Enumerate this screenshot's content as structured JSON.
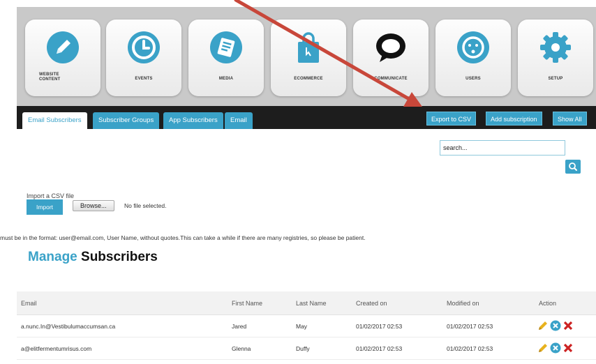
{
  "modules": [
    {
      "label": "WEBSITE",
      "label2": "CONTENT",
      "icon": "pencil-icon"
    },
    {
      "label": "EVENTS",
      "icon": "clock-icon"
    },
    {
      "label": "MEDIA",
      "icon": "media-list-icon"
    },
    {
      "label": "ECOMMERCE",
      "icon": "shopping-bag-icon"
    },
    {
      "label": "COMMUNICATE",
      "icon": "speech-bubble-icon"
    },
    {
      "label": "USERS",
      "icon": "user-face-icon"
    },
    {
      "label": "SETUP",
      "icon": "gear-icon"
    }
  ],
  "tabs": [
    "Email Subscribers",
    "Subscriber Groups",
    "App Subscribers",
    "Email"
  ],
  "actions": {
    "export": "Export to CSV",
    "add": "Add subscription",
    "show_all": "Show All"
  },
  "search": {
    "placeholder": "search..."
  },
  "import": {
    "label": "Import a CSV file",
    "button": "Import",
    "browse": "Browse...",
    "no_file": "No file selected."
  },
  "format_note": "must be in the format: user@email.com, User Name, without quotes.This can take a while if there are many registries, so please be patient.",
  "title": {
    "word1": "Manage",
    "word2": "Subscribers"
  },
  "table": {
    "columns": [
      "Email",
      "First Name",
      "Last Name",
      "Created on",
      "Modified on",
      "Action"
    ],
    "rows": [
      [
        "a.nunc.In@Vestibulumaccumsan.ca",
        "Jared",
        "May",
        "01/02/2017 02:53",
        "01/02/2017 02:53"
      ],
      [
        "a@elitfermentumrisus.com",
        "Glenna",
        "Duffy",
        "01/02/2017 02:53",
        "01/02/2017 02:53"
      ]
    ]
  },
  "colors": {
    "accent": "#3aa2c8",
    "tab_bar": "#1d1d1d",
    "arrow": "#c8473a",
    "delete": "#cc2222",
    "edit": "#e8b21e"
  }
}
